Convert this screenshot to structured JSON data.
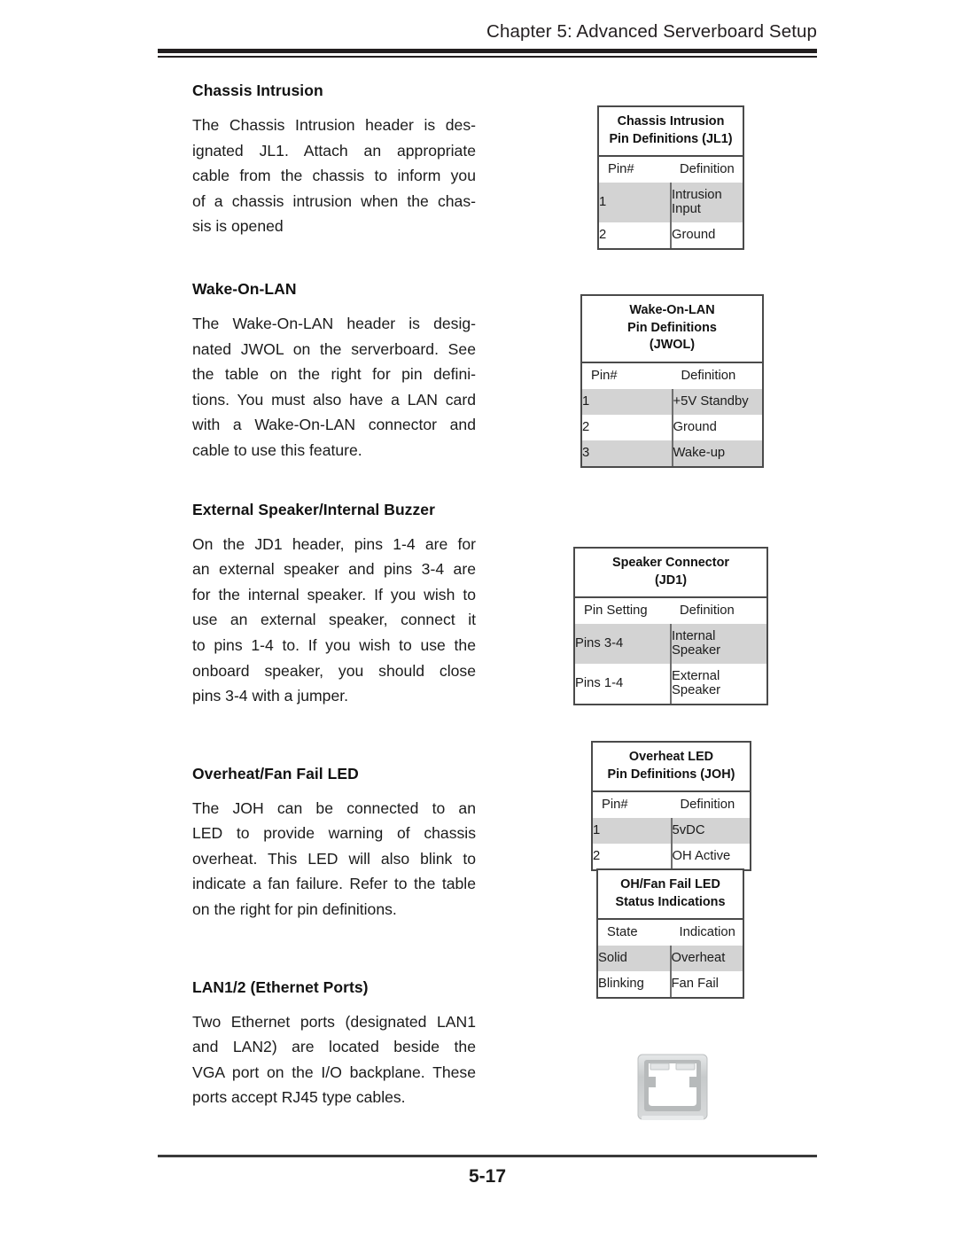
{
  "header": {
    "title": "Chapter 5: Advanced Serverboard Setup"
  },
  "footer": {
    "page_number": "5-17"
  },
  "sections": [
    {
      "heading": "Chassis Intrusion",
      "lines": [
        "The Chassis Intrusion header is des-",
        "ignated JL1. Attach an appropriate",
        "cable from the chassis to inform you",
        "of a chassis intrusion when the chas-",
        "sis is opened"
      ]
    },
    {
      "heading": "Wake-On-LAN",
      "lines": [
        "The Wake-On-LAN header is desig-",
        "nated JWOL on the serverboard. See",
        "the table on the right for pin defini-",
        "tions. You must also have a LAN card",
        "with a Wake-On-LAN connector and",
        "cable to use this feature."
      ]
    },
    {
      "heading": "External Speaker/Internal Buzzer",
      "lines": [
        "On the JD1 header, pins 1-4 are for",
        "an external speaker and pins 3-4 are",
        "for the internal speaker. If you wish to",
        "use an external speaker, connect it",
        "to pins 1-4 to. If you wish to use the",
        "onboard speaker, you should close",
        "pins 3-4 with a jumper."
      ]
    },
    {
      "heading": "Overheat/Fan Fail LED",
      "lines": [
        "The JOH can be connected to an",
        "LED to provide warning of chassis",
        "overheat. This LED will also blink to",
        "indicate a fan failure. Refer to the table",
        "on the right for pin definitions."
      ]
    },
    {
      "heading": "LAN1/2 (Ethernet Ports)",
      "lines": [
        "Two Ethernet ports (designated LAN1",
        "and LAN2) are located beside the",
        "VGA port on the I/O backplane. These",
        "ports accept RJ45 type cables."
      ]
    }
  ],
  "tables": [
    {
      "id": "chassis-intrusion",
      "caption": [
        "Chassis Intrusion",
        "Pin Definitions (JL1)"
      ],
      "columns": [
        "Pin#",
        "Definition"
      ],
      "rows": [
        {
          "cells": [
            "1",
            "Intrusion Input"
          ],
          "shaded": true
        },
        {
          "cells": [
            "2",
            "Ground"
          ],
          "shaded": false
        }
      ]
    },
    {
      "id": "wake-on-lan",
      "caption": [
        "Wake-On-LAN",
        "Pin Definitions",
        "(JWOL)"
      ],
      "columns": [
        "Pin#",
        "Definition"
      ],
      "rows": [
        {
          "cells": [
            "1",
            "+5V Standby"
          ],
          "shaded": true
        },
        {
          "cells": [
            "2",
            "Ground"
          ],
          "shaded": false
        },
        {
          "cells": [
            "3",
            "Wake-up"
          ],
          "shaded": true
        }
      ]
    },
    {
      "id": "speaker-connector",
      "caption": [
        "Speaker Connector",
        "(JD1)"
      ],
      "columns": [
        "Pin Setting",
        "Definition"
      ],
      "rows": [
        {
          "cells": [
            "Pins 3-4",
            "Internal Speaker"
          ],
          "shaded": true
        },
        {
          "cells": [
            "Pins 1-4",
            "External Speaker"
          ],
          "shaded": false
        }
      ]
    },
    {
      "id": "overheat-led",
      "caption": [
        "Overheat LED",
        "Pin Definitions (JOH)"
      ],
      "columns": [
        "Pin#",
        "Definition"
      ],
      "rows": [
        {
          "cells": [
            "1",
            "5vDC"
          ],
          "shaded": true
        },
        {
          "cells": [
            "2",
            "OH Active"
          ],
          "shaded": false
        }
      ]
    },
    {
      "id": "oh-fan-fail-led",
      "caption": [
        "OH/Fan Fail LED",
        "Status Indications"
      ],
      "columns": [
        "State",
        "Indication"
      ],
      "rows": [
        {
          "cells": [
            "Solid",
            "Overheat"
          ],
          "shaded": true
        },
        {
          "cells": [
            "Blinking",
            "Fan Fail"
          ],
          "shaded": false
        }
      ]
    }
  ],
  "figures": [
    {
      "id": "rj45-port",
      "name": "rj45-ethernet-port-icon"
    }
  ],
  "colors": {
    "text": "#1b1b1b",
    "rule": "#231f20",
    "table_border": "#4a4a4a",
    "row_shade": "#d3d3d3",
    "rj45_body": "#c9cbcc",
    "rj45_opening": "#ffffff"
  }
}
